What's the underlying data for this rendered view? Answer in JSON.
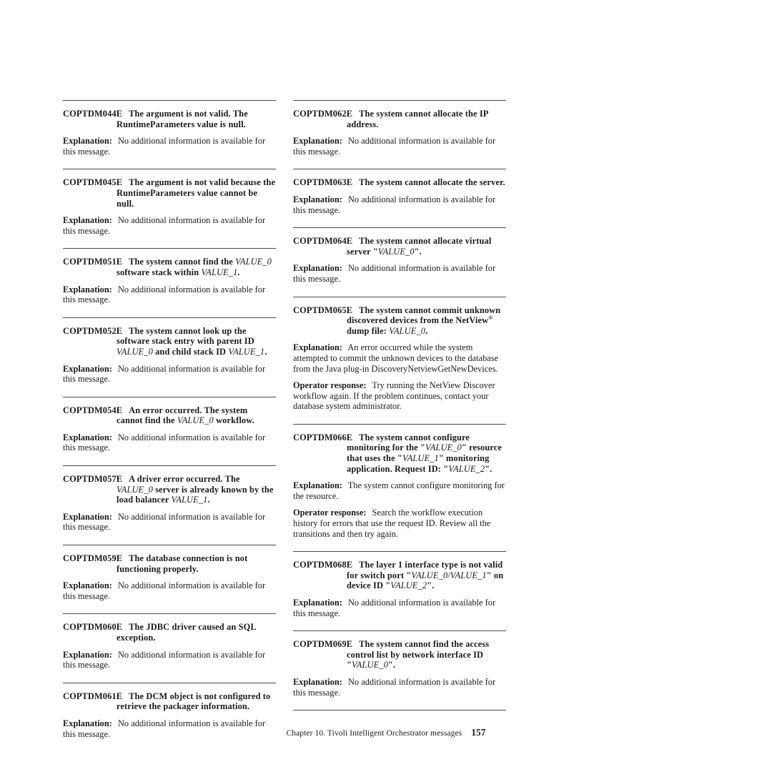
{
  "footer": {
    "chapter_text": "Chapter 10. Tivoli Intelligent Orchestrator messages",
    "page_number": "157"
  },
  "labels": {
    "explanation": "Explanation:",
    "operator_response": "Operator response:"
  },
  "common": {
    "no_additional_info": "No additional information is available for this message."
  },
  "colors": {
    "text": "#1b1b1b",
    "rule": "#4a4a4a",
    "background": "#ffffff"
  },
  "left_column": {
    "messages": [
      {
        "id": "COPTDM044E",
        "title_parts": [
          {
            "text": "The argument is not valid. The RuntimeParameters value is null.",
            "style": "bold"
          }
        ],
        "title_plain": "The argument is not valid. The RuntimeParameters value is null.",
        "explanation": "No additional information is available for this message."
      },
      {
        "id": "COPTDM045E",
        "title_parts": [
          {
            "text": "The argument is not valid because the RuntimeParameters value cannot be null.",
            "style": "bold"
          }
        ],
        "title_plain": "The argument is not valid because the RuntimeParameters value cannot be null.",
        "explanation": "No additional information is available for this message."
      },
      {
        "id": "COPTDM051E",
        "title_parts": [
          {
            "text": "The system cannot find the ",
            "style": "bold"
          },
          {
            "text": "VALUE_0",
            "style": "var"
          },
          {
            "text": " software stack within ",
            "style": "bold"
          },
          {
            "text": "VALUE_1",
            "style": "var"
          },
          {
            "text": ".",
            "style": "bold"
          }
        ],
        "title_plain": "The system cannot find the VALUE_0 software stack within VALUE_1.",
        "explanation": "No additional information is available for this message."
      },
      {
        "id": "COPTDM052E",
        "title_parts": [
          {
            "text": "The system cannot look up the software stack entry with parent ID ",
            "style": "bold"
          },
          {
            "text": "VALUE_0",
            "style": "var"
          },
          {
            "text": " and child stack ID ",
            "style": "bold"
          },
          {
            "text": "VALUE_1",
            "style": "var"
          },
          {
            "text": ".",
            "style": "bold"
          }
        ],
        "title_plain": "The system cannot look up the software stack entry with parent ID VALUE_0 and child stack ID VALUE_1.",
        "explanation": "No additional information is available for this message."
      },
      {
        "id": "COPTDM054E",
        "title_parts": [
          {
            "text": "An error occurred. The system cannot find the ",
            "style": "bold"
          },
          {
            "text": "VALUE_0",
            "style": "var"
          },
          {
            "text": " workflow.",
            "style": "bold"
          }
        ],
        "title_plain": "An error occurred. The system cannot find the VALUE_0 workflow.",
        "explanation": "No additional information is available for this message."
      },
      {
        "id": "COPTDM057E",
        "title_parts": [
          {
            "text": "A driver error occurred. The ",
            "style": "bold"
          },
          {
            "text": "VALUE_0",
            "style": "var"
          },
          {
            "text": " server is already known by the load balancer ",
            "style": "bold"
          },
          {
            "text": "VALUE_1",
            "style": "var"
          },
          {
            "text": ".",
            "style": "bold"
          }
        ],
        "title_plain": "A driver error occurred. The VALUE_0 server is already known by the load balancer VALUE_1.",
        "explanation": "No additional information is available for this message."
      },
      {
        "id": "COPTDM059E",
        "title_parts": [
          {
            "text": "The database connection is not functioning properly.",
            "style": "bold"
          }
        ],
        "title_plain": "The database connection is not functioning properly.",
        "explanation": "No additional information is available for this message."
      },
      {
        "id": "COPTDM060E",
        "title_parts": [
          {
            "text": "The JDBC driver caused an SQL exception.",
            "style": "bold"
          }
        ],
        "title_plain": "The JDBC driver caused an SQL exception.",
        "explanation": "No additional information is available for this message."
      },
      {
        "id": "COPTDM061E",
        "title_parts": [
          {
            "text": "The DCM object is not configured to retrieve the packager information.",
            "style": "bold"
          }
        ],
        "title_plain": "The DCM object is not configured to retrieve the packager information.",
        "explanation": "No additional information is available for this message."
      }
    ]
  },
  "right_column": {
    "messages": [
      {
        "id": "COPTDM062E",
        "title_parts": [
          {
            "text": "The system cannot allocate the IP address.",
            "style": "bold"
          }
        ],
        "title_plain": "The system cannot allocate the IP address.",
        "explanation": "No additional information is available for this message."
      },
      {
        "id": "COPTDM063E",
        "single_line": true,
        "title_parts": [
          {
            "text": "The system cannot allocate the server.",
            "style": "bold"
          }
        ],
        "title_plain": "The system cannot allocate the server.",
        "explanation": "No additional information is available for this message."
      },
      {
        "id": "COPTDM064E",
        "title_parts": [
          {
            "text": "The system cannot allocate virtual server \"",
            "style": "bold"
          },
          {
            "text": "VALUE_0",
            "style": "var"
          },
          {
            "text": "\".",
            "style": "bold"
          }
        ],
        "title_plain": "The system cannot allocate virtual server \"VALUE_0\".",
        "explanation": "No additional information is available for this message."
      },
      {
        "id": "COPTDM065E",
        "title_parts": [
          {
            "text": "The system cannot commit unknown discovered devices from the NetView",
            "style": "bold"
          },
          {
            "text": "®",
            "style": "reg"
          },
          {
            "text": " dump file: ",
            "style": "bold"
          },
          {
            "text": "VALUE_0",
            "style": "var"
          },
          {
            "text": ".",
            "style": "bold"
          }
        ],
        "title_plain": "The system cannot commit unknown discovered devices from the NetView® dump file: VALUE_0.",
        "explanation": "An error occurred while the system attempted to commit the unknown devices to the database from the Java plug-in DiscoveryNetviewGetNewDevices.",
        "operator_response": "Try running the NetView Discover workflow again. If the problem continues, contact your database system administrator."
      },
      {
        "id": "COPTDM066E",
        "title_parts": [
          {
            "text": "The system cannot configure monitoring for the \"",
            "style": "bold"
          },
          {
            "text": "VALUE_0",
            "style": "var"
          },
          {
            "text": "\" resource that uses the \"",
            "style": "bold"
          },
          {
            "text": "VALUE_1",
            "style": "var"
          },
          {
            "text": "\" monitoring application. Request ID: \"",
            "style": "bold"
          },
          {
            "text": "VALUE_2",
            "style": "var"
          },
          {
            "text": "\".",
            "style": "bold"
          }
        ],
        "title_plain": "The system cannot configure monitoring for the \"VALUE_0\" resource that uses the \"VALUE_1\" monitoring application. Request ID: \"VALUE_2\".",
        "explanation": "The system cannot configure monitoring for the resource.",
        "operator_response": "Search the workflow execution history for errors that use the request ID. Review all the transitions and then try again."
      },
      {
        "id": "COPTDM068E",
        "title_parts": [
          {
            "text": "The layer 1 interface type is not valid for switch port \"",
            "style": "bold"
          },
          {
            "text": "VALUE_0/VALUE_1",
            "style": "var"
          },
          {
            "text": "\" on device ID \"",
            "style": "bold"
          },
          {
            "text": "VALUE_2",
            "style": "var"
          },
          {
            "text": "\".",
            "style": "bold"
          }
        ],
        "title_plain": "The layer 1 interface type is not valid for switch port \"VALUE_0/VALUE_1\" on device ID \"VALUE_2\".",
        "explanation": "No additional information is available for this message."
      },
      {
        "id": "COPTDM069E",
        "title_parts": [
          {
            "text": "The system cannot find the access control list by network interface ID \"",
            "style": "bold"
          },
          {
            "text": "VALUE_0",
            "style": "var"
          },
          {
            "text": "\".",
            "style": "bold"
          }
        ],
        "title_plain": "The system cannot find the access control list by network interface ID \"VALUE_0\".",
        "explanation": "No additional information is available for this message."
      }
    ],
    "trailing_rule": true
  }
}
